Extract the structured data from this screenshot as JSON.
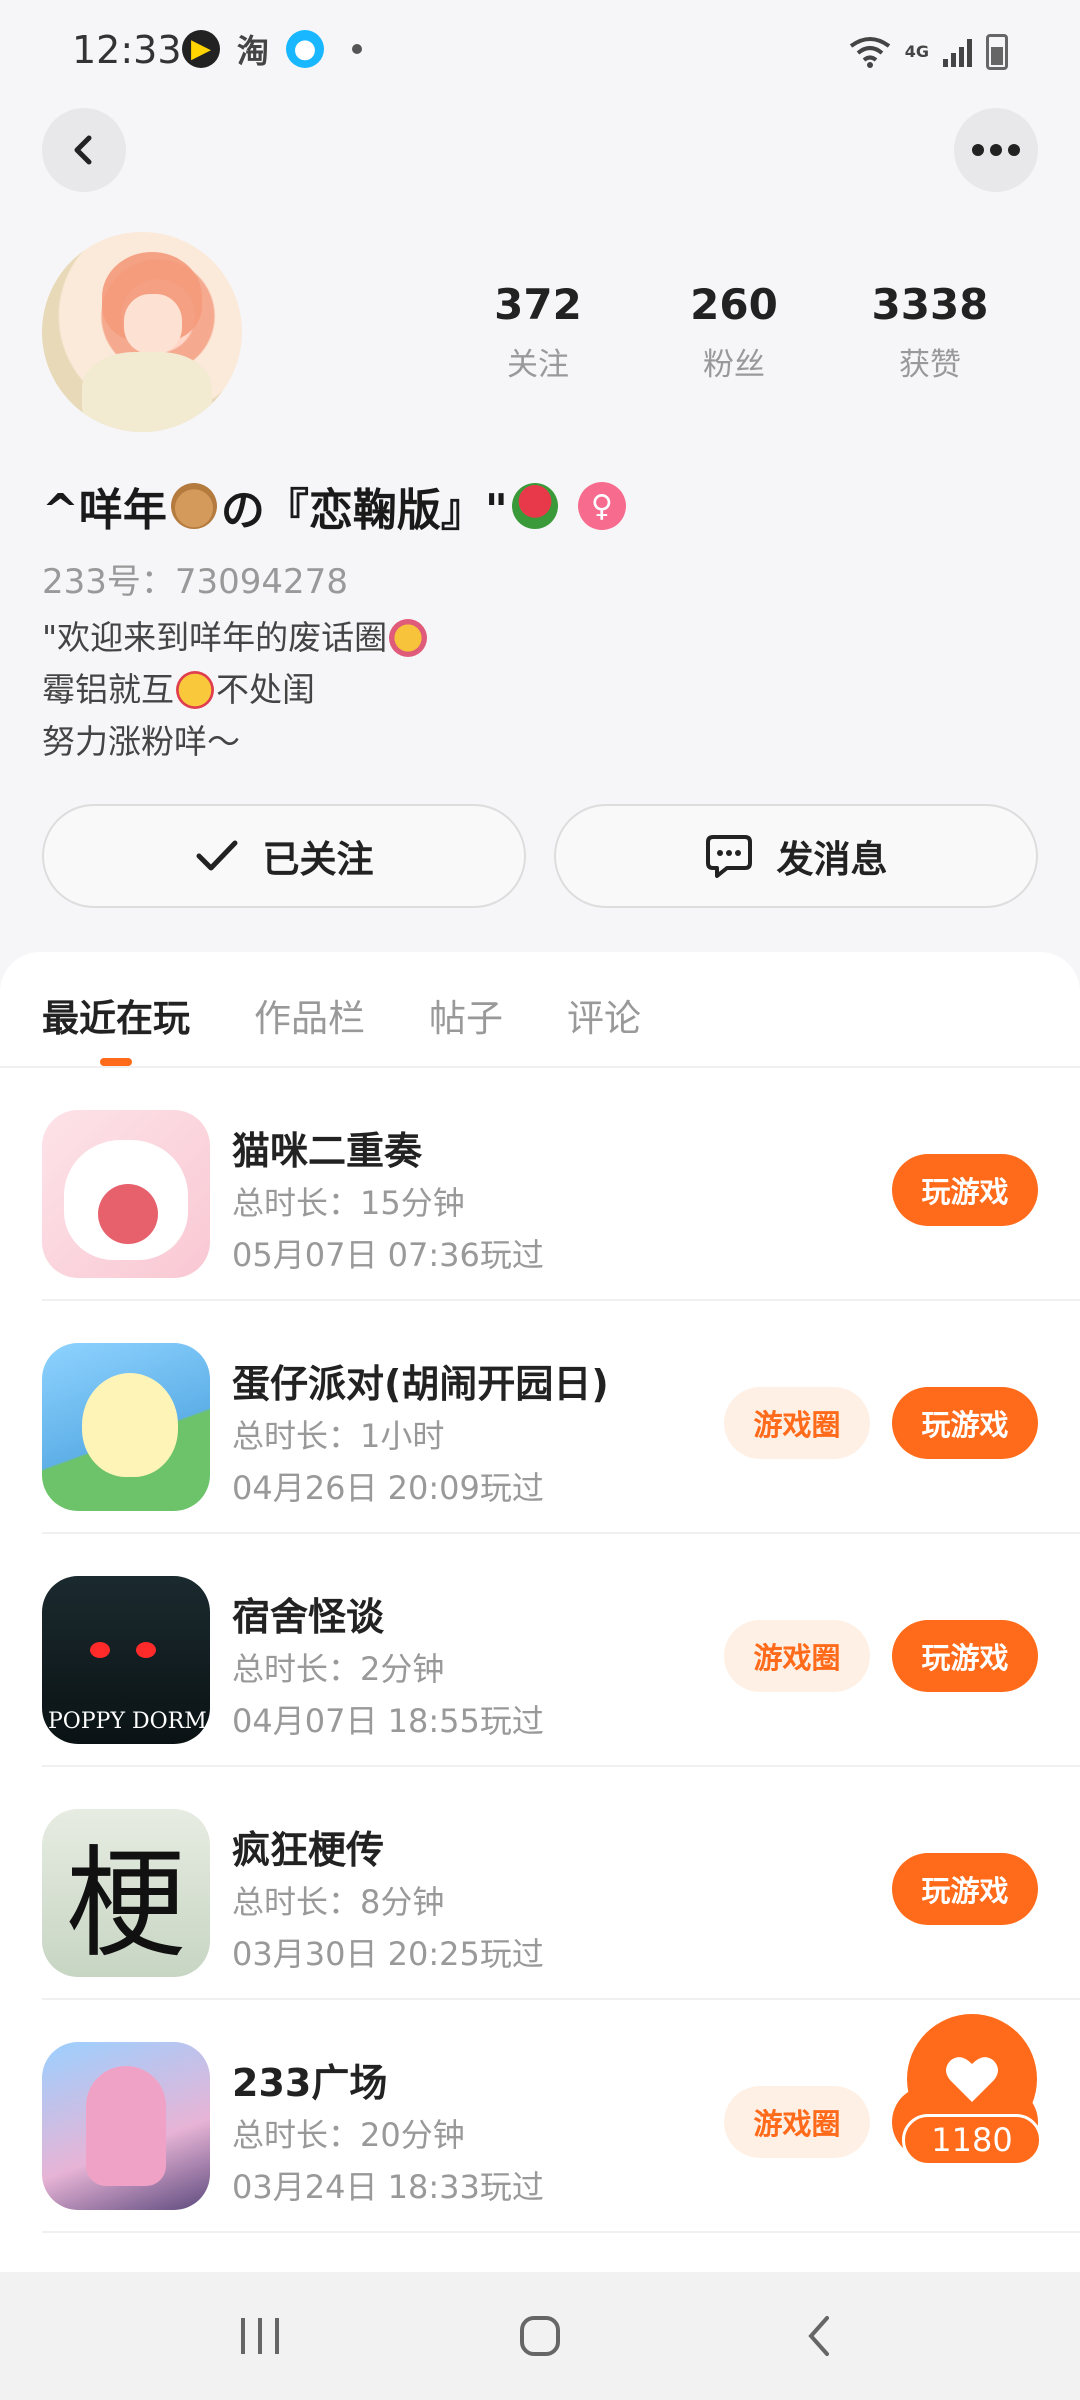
{
  "status_bar": {
    "time": "12:33",
    "network": "4G",
    "app_icons": [
      "video-app-icon",
      "taobao-icon",
      "qq-icon"
    ]
  },
  "top_actions": {
    "back_icon": "chevron-left-icon",
    "more_icon": "more-dots-icon"
  },
  "profile": {
    "stats": [
      {
        "value": "372",
        "label": "关注"
      },
      {
        "value": "260",
        "label": "粉丝"
      },
      {
        "value": "3338",
        "label": "获赞"
      }
    ],
    "nickname_part1": "^咩年",
    "nickname_part2": "の『恋鞠版』\"",
    "gender_symbol": "♀",
    "user_id": "233号：73094278",
    "bio_line1": "\"欢迎来到咩年的废话圈",
    "bio_line2a": "霉铝就互",
    "bio_line2b": "不处闺",
    "bio_line3": "努力涨粉咩～"
  },
  "actions": {
    "follow_label": "已关注",
    "message_label": "发消息"
  },
  "tabs": [
    {
      "label": "最近在玩",
      "active": true
    },
    {
      "label": "作品栏",
      "active": false
    },
    {
      "label": "帖子",
      "active": false
    },
    {
      "label": "评论",
      "active": false
    }
  ],
  "games": [
    {
      "name": "猫咪二重奏",
      "duration": "总时长：15分钟",
      "last_played": "05月07日 07:36玩过",
      "has_circle": false
    },
    {
      "name": "蛋仔派对(胡闹开园日)",
      "duration": "总时长：1小时",
      "last_played": "04月26日 20:09玩过",
      "has_circle": true
    },
    {
      "name": "宿舍怪谈",
      "duration": "总时长：2分钟",
      "last_played": "04月07日 18:55玩过",
      "has_circle": true
    },
    {
      "name": "疯狂梗传",
      "duration": "总时长：8分钟",
      "last_played": "03月30日 20:25玩过",
      "has_circle": false
    },
    {
      "name": "233广场",
      "duration": "总时长：20分钟",
      "last_played": "03月24日 18:33玩过",
      "has_circle": true
    }
  ],
  "game_buttons": {
    "play_label": "玩游戏",
    "circle_label": "游戏圈"
  },
  "game_icon_text": {
    "horror": "POPPY DORM",
    "geng": "梗"
  },
  "like_fab": {
    "count": "1180",
    "icon": "heart-icon"
  },
  "colors": {
    "accent": "#ff6b1a",
    "accent_light": "#fff0e6",
    "background": "#f6f6f8"
  }
}
